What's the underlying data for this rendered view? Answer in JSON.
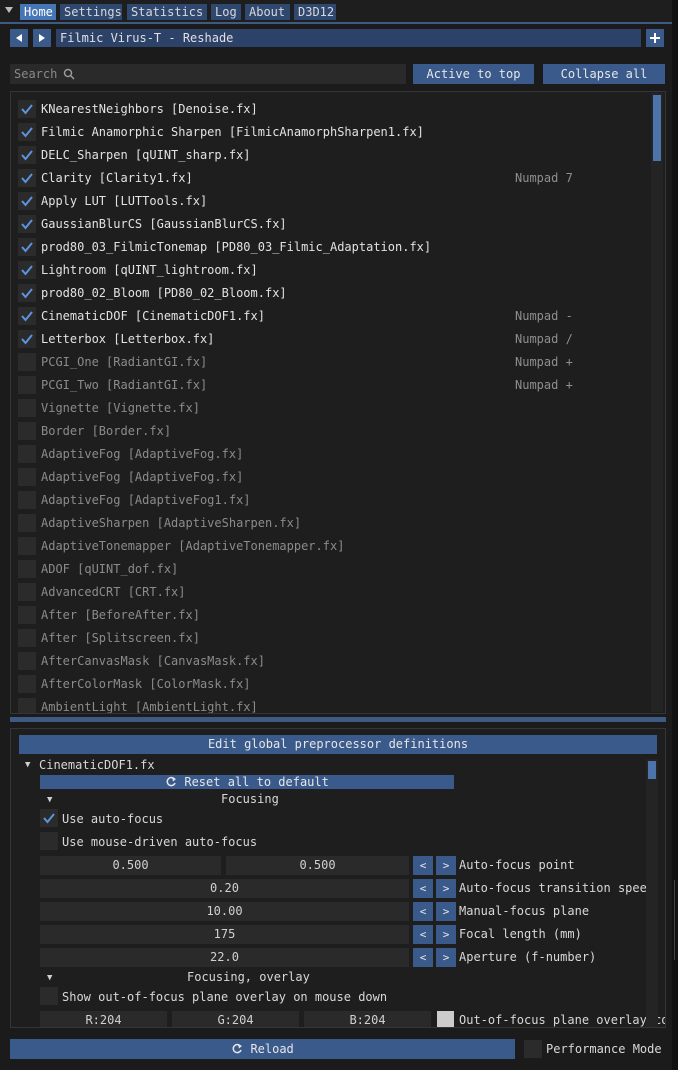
{
  "tabs": [
    "Home",
    "Settings",
    "Statistics",
    "Log",
    "About",
    "D3D12"
  ],
  "preset": {
    "name": "Filmic Virus-T - Reshade"
  },
  "search": {
    "label": "Search"
  },
  "buttons": {
    "active_to_top": "Active to top",
    "collapse_all": "Collapse all"
  },
  "effects": [
    {
      "label": "KNearestNeighbors [Denoise.fx]",
      "checked": true,
      "hotkey": ""
    },
    {
      "label": "Filmic Anamorphic Sharpen [FilmicAnamorphSharpen1.fx]",
      "checked": true,
      "hotkey": ""
    },
    {
      "label": "DELC_Sharpen [qUINT_sharp.fx]",
      "checked": true,
      "hotkey": ""
    },
    {
      "label": "Clarity [Clarity1.fx]",
      "checked": true,
      "hotkey": "Numpad 7"
    },
    {
      "label": "Apply LUT [LUTTools.fx]",
      "checked": true,
      "hotkey": ""
    },
    {
      "label": "GaussianBlurCS [GaussianBlurCS.fx]",
      "checked": true,
      "hotkey": ""
    },
    {
      "label": "prod80_03_FilmicTonemap [PD80_03_Filmic_Adaptation.fx]",
      "checked": true,
      "hotkey": ""
    },
    {
      "label": "Lightroom [qUINT_lightroom.fx]",
      "checked": true,
      "hotkey": ""
    },
    {
      "label": "prod80_02_Bloom [PD80_02_Bloom.fx]",
      "checked": true,
      "hotkey": ""
    },
    {
      "label": "CinematicDOF [CinematicDOF1.fx]",
      "checked": true,
      "hotkey": "Numpad -"
    },
    {
      "label": "Letterbox [Letterbox.fx]",
      "checked": true,
      "hotkey": "Numpad /"
    },
    {
      "label": "PCGI_One [RadiantGI.fx]",
      "checked": false,
      "hotkey": "Numpad +"
    },
    {
      "label": "PCGI_Two [RadiantGI.fx]",
      "checked": false,
      "hotkey": "Numpad +"
    },
    {
      "label": "Vignette [Vignette.fx]",
      "checked": false,
      "hotkey": ""
    },
    {
      "label": "Border [Border.fx]",
      "checked": false,
      "hotkey": ""
    },
    {
      "label": "AdaptiveFog [AdaptiveFog.fx]",
      "checked": false,
      "hotkey": ""
    },
    {
      "label": "AdaptiveFog [AdaptiveFog.fx]",
      "checked": false,
      "hotkey": ""
    },
    {
      "label": "AdaptiveFog [AdaptiveFog1.fx]",
      "checked": false,
      "hotkey": ""
    },
    {
      "label": "AdaptiveSharpen [AdaptiveSharpen.fx]",
      "checked": false,
      "hotkey": ""
    },
    {
      "label": "AdaptiveTonemapper [AdaptiveTonemapper.fx]",
      "checked": false,
      "hotkey": ""
    },
    {
      "label": "ADOF [qUINT_dof.fx]",
      "checked": false,
      "hotkey": ""
    },
    {
      "label": "AdvancedCRT [CRT.fx]",
      "checked": false,
      "hotkey": ""
    },
    {
      "label": "After [BeforeAfter.fx]",
      "checked": false,
      "hotkey": ""
    },
    {
      "label": "After [Splitscreen.fx]",
      "checked": false,
      "hotkey": ""
    },
    {
      "label": "AfterCanvasMask [CanvasMask.fx]",
      "checked": false,
      "hotkey": ""
    },
    {
      "label": "AfterColorMask [ColorMask.fx]",
      "checked": false,
      "hotkey": ""
    },
    {
      "label": "AmbientLight [AmbientLight.fx]",
      "checked": false,
      "hotkey": ""
    }
  ],
  "editor": {
    "global_defs": "Edit global preprocessor definitions",
    "file": "CinematicDOF1.fx",
    "reset": "Reset all to default",
    "sections": {
      "focusing": "Focusing",
      "overlay": "Focusing, overlay"
    },
    "use_autofocus": {
      "label": "Use auto-focus",
      "checked": true
    },
    "use_mouse_autofocus": {
      "label": "Use mouse-driven auto-focus",
      "checked": false
    },
    "autofocus_point": {
      "x": "0.500",
      "y": "0.500",
      "label": "Auto-focus point"
    },
    "transition_speed": {
      "value": "0.20",
      "label": "Auto-focus transition speed"
    },
    "manual_focus": {
      "value": "10.00",
      "label": "Manual-focus plane"
    },
    "focal_length": {
      "value": "175",
      "label": "Focal length (mm)"
    },
    "aperture": {
      "value": "22.0",
      "label": "Aperture (f-number)"
    },
    "show_overlay": {
      "label": "Show out-of-focus plane overlay on mouse down",
      "checked": false
    },
    "overlay_color": {
      "r": "R:204",
      "g": "G:204",
      "b": "B:204",
      "label": "Out-of-focus plane overlay color",
      "swatch": "#cccccc"
    },
    "dec": "<",
    "inc": ">"
  },
  "footer": {
    "reload": "Reload",
    "performance_mode": "Performance Mode"
  },
  "colors": {
    "accent": "#3b5a8c",
    "active_tab": "#4676b6",
    "check": "#5b94e0"
  }
}
